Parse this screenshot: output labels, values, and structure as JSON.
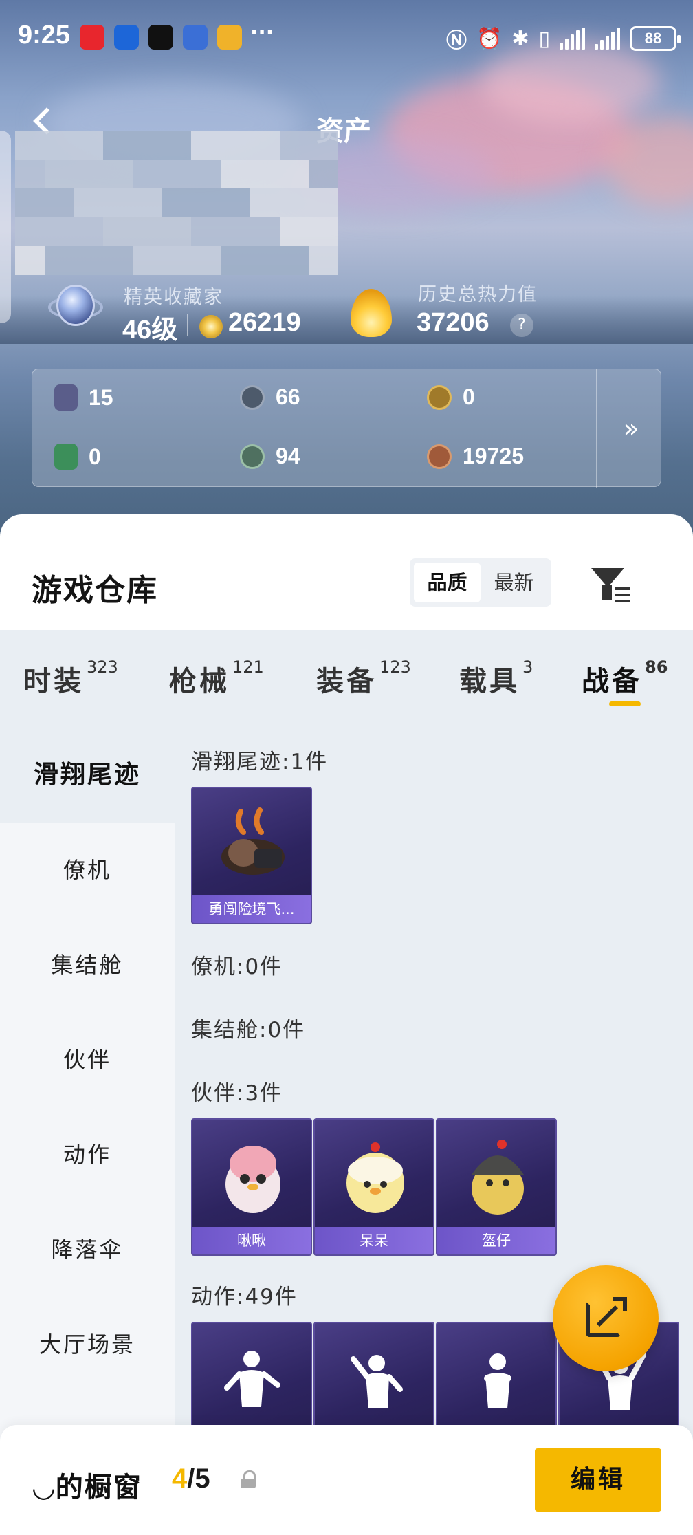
{
  "status_bar": {
    "time": "9:25",
    "more": "···",
    "battery": "88"
  },
  "nav": {
    "title": "资产"
  },
  "stats": {
    "collector_title": "精英收藏家",
    "level": "46级",
    "coins": "26219",
    "heat_label": "历史总热力值",
    "heat_value": "37206",
    "help": "?"
  },
  "resources": [
    {
      "value": "15",
      "color": "#5a5d8a"
    },
    {
      "value": "66",
      "color": "#4d5a6b"
    },
    {
      "value": "0",
      "color": "#a07a2a"
    },
    {
      "value": "0",
      "color": "#3c8f5a"
    },
    {
      "value": "94",
      "color": "#4f7060"
    },
    {
      "value": "19725",
      "color": "#a05a3a"
    }
  ],
  "resources_more": "»",
  "warehouse": {
    "title": "游戏仓库",
    "sort": [
      "品质",
      "最新"
    ],
    "tabs": [
      {
        "label": "时装",
        "count": "323"
      },
      {
        "label": "枪械",
        "count": "121"
      },
      {
        "label": "装备",
        "count": "123"
      },
      {
        "label": "载具",
        "count": "3"
      },
      {
        "label": "战备",
        "count": "86"
      }
    ],
    "side_nav": [
      "滑翔尾迹",
      "僚机",
      "集结舱",
      "伙伴",
      "动作",
      "降落伞",
      "大厅场景"
    ],
    "sections": [
      {
        "label": "滑翔尾迹:1件",
        "items": [
          "勇闯险境飞..."
        ]
      },
      {
        "label": "僚机:0件"
      },
      {
        "label": "集结舱:0件"
      },
      {
        "label": "伙伴:3件",
        "items": [
          "啾啾",
          "呆呆",
          "盔仔"
        ]
      },
      {
        "label": "动作:49件"
      }
    ]
  },
  "bottom": {
    "showcase_label": "的橱窗",
    "count_current": "4",
    "count_total": "/5",
    "edit": "编辑"
  },
  "colors": {
    "accent": "#f5b800",
    "card_purple": "#2d2460"
  }
}
